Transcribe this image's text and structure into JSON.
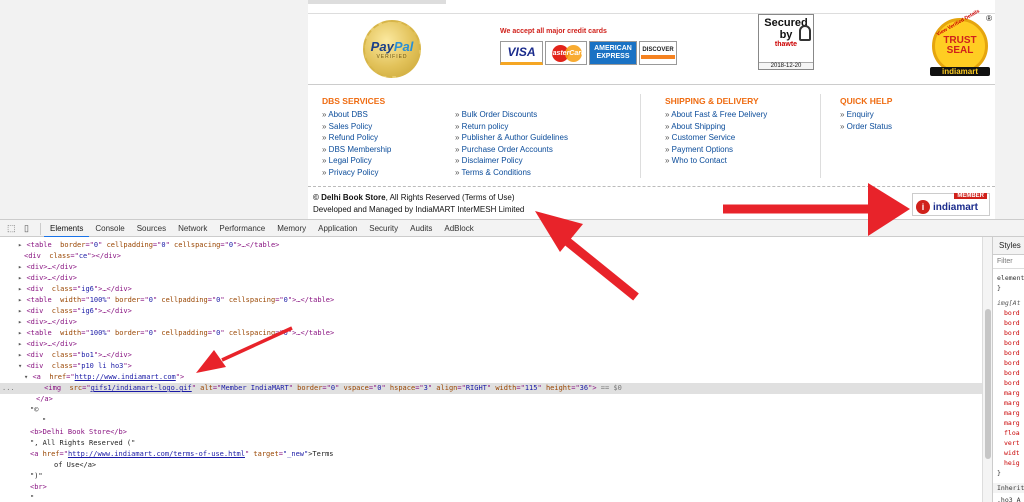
{
  "site": {
    "paypal": {
      "brand_a": "Pay",
      "brand_b": "Pal",
      "sub": "VERIFIED"
    },
    "cards": {
      "title": "We accept all major credit cards",
      "visa": "VISA",
      "mastercard": "MasterCard",
      "amex_line1": "AMERICAN",
      "amex_line2": "EXPRESS",
      "discover": "DISCOVER"
    },
    "secured": {
      "line1": "Secured",
      "line2": "by",
      "brand": "thawte",
      "date": "2018-12-20"
    },
    "trust_seal": {
      "arc": "View Verified Details",
      "line1": "TRUST",
      "line2": "SEAL",
      "brand": "indiamart",
      "reg": "®"
    },
    "footer": {
      "columns": [
        {
          "heading": "DBS SERVICES",
          "items": [
            "About DBS",
            "Sales Policy",
            "Refund Policy",
            "DBS Membership",
            "Legal Policy",
            "Privacy Policy"
          ]
        },
        {
          "heading": "",
          "items": [
            "Bulk Order Discounts",
            "Return policy",
            "Publisher & Author Guidelines",
            "Purchase Order Accounts",
            "Disclaimer Policy",
            "Terms & Conditions"
          ]
        },
        {
          "heading": "SHIPPING & DELIVERY",
          "items": [
            "About Fast & Free Delivery",
            "About Shipping",
            "Customer Service",
            "Payment Options",
            "Who to Contact"
          ]
        },
        {
          "heading": "QUICK HELP",
          "items": [
            "Enquiry",
            "Order Status"
          ]
        }
      ],
      "copyright_brand": "© Delhi Book Store",
      "copyright_rest": ", All Rights Reserved (Terms of Use)",
      "developed": "Developed and Managed by IndiaMART InterMESH Limited",
      "member_badge": "MEMBER",
      "member_brand": "indiamart",
      "member_icon_letter": "i"
    }
  },
  "devtools": {
    "tabs": [
      "Elements",
      "Console",
      "Sources",
      "Network",
      "Performance",
      "Memory",
      "Application",
      "Security",
      "Audits",
      "AdBlock"
    ],
    "active_tab": "Elements",
    "lines": [
      {
        "indent": 2,
        "tri": "▸",
        "pre": "<table ",
        "attrs": [
          [
            "border",
            "\"0\""
          ],
          [
            "cellpadding",
            "\"0\""
          ],
          [
            "cellspacing",
            "\"0\""
          ]
        ],
        "post": ">…</table>"
      },
      {
        "indent": 3,
        "tri": "",
        "pre": "<div ",
        "attrs": [
          [
            "class",
            "\"ce\""
          ]
        ],
        "post": "></div>"
      },
      {
        "indent": 2,
        "tri": "▸",
        "pre": "<div>…</div>",
        "attrs": [],
        "post": ""
      },
      {
        "indent": 2,
        "tri": "▸",
        "pre": "<div>…</div>",
        "attrs": [],
        "post": ""
      },
      {
        "indent": 2,
        "tri": "▸",
        "pre": "<div ",
        "attrs": [
          [
            "class",
            "\"ig6\""
          ]
        ],
        "post": ">…</div>"
      },
      {
        "indent": 2,
        "tri": "▸",
        "pre": "<table ",
        "attrs": [
          [
            "width",
            "\"100%\""
          ],
          [
            "border",
            "\"0\""
          ],
          [
            "cellpadding",
            "\"0\""
          ],
          [
            "cellspacing",
            "\"0\""
          ]
        ],
        "post": ">…</table>"
      },
      {
        "indent": 2,
        "tri": "▸",
        "pre": "<div ",
        "attrs": [
          [
            "class",
            "\"ig6\""
          ]
        ],
        "post": ">…</div>"
      },
      {
        "indent": 2,
        "tri": "▸",
        "pre": "<div>…</div>",
        "attrs": [],
        "post": ""
      },
      {
        "indent": 2,
        "tri": "▸",
        "pre": "<table ",
        "attrs": [
          [
            "width",
            "\"100%\""
          ],
          [
            "border",
            "\"0\""
          ],
          [
            "cellpadding",
            "\"0\""
          ],
          [
            "cellspacing",
            "\"0\""
          ]
        ],
        "post": ">…</table>"
      },
      {
        "indent": 2,
        "tri": "▸",
        "pre": "<div>…</div>",
        "attrs": [],
        "post": ""
      },
      {
        "indent": 2,
        "tri": "▸",
        "pre": "<div ",
        "attrs": [
          [
            "class",
            "\"bo1\""
          ]
        ],
        "post": ">…</div>"
      },
      {
        "indent": 2,
        "tri": "▾",
        "pre": "<div ",
        "attrs": [
          [
            "class",
            "\"p10 li ho3\""
          ]
        ],
        "post": ">"
      },
      {
        "indent": 3,
        "tri": "▾",
        "pre": "<a ",
        "attrs": [
          [
            "href",
            "link:http://www.indiamart.com"
          ]
        ],
        "post": ">"
      }
    ],
    "selected_line": {
      "prefix": "...",
      "tag": "<img ",
      "attrs": [
        [
          "src",
          "link:gifs1/indiamart-logo.gif"
        ],
        [
          "alt",
          "\"Member IndiaMART\""
        ],
        [
          "border",
          "\"0\""
        ],
        [
          "vspace",
          "\"0\""
        ],
        [
          "hspace",
          "\"3\""
        ],
        [
          "align",
          "\"RIGHT\""
        ],
        [
          "width",
          "\"115\""
        ],
        [
          "height",
          "\"36\""
        ]
      ],
      "post": ">",
      "suffix": " == $0"
    },
    "after_lines": [
      {
        "indent": 5,
        "kind": "tag",
        "text": "</a>"
      },
      {
        "indent": 4,
        "kind": "txt",
        "text": "\"©"
      },
      {
        "indent": 6,
        "kind": "txt",
        "text": "\""
      },
      {
        "indent": 4,
        "kind": "tag",
        "text": "<b>Delhi Book Store</b>"
      },
      {
        "indent": 4,
        "kind": "txt",
        "text": "\", All Rights Reserved (\""
      },
      {
        "indent": 4,
        "kind": "alink",
        "href": "http://www.indiamart.com/terms-of-use.html",
        "target": "\"_new\"",
        "tail": ">Terms"
      },
      {
        "indent": 8,
        "kind": "txt",
        "text": "of Use</a>"
      },
      {
        "indent": 4,
        "kind": "txt",
        "text": "\")\""
      },
      {
        "indent": 4,
        "kind": "tag",
        "text": "<br>"
      },
      {
        "indent": 4,
        "kind": "txt",
        "text": "\""
      }
    ],
    "styles": {
      "tab": "Styles",
      "filter_placeholder": "Filter",
      "element_line": "element",
      "element_close": "}",
      "rule_selector": "img[At",
      "props": [
        "bord",
        "bord",
        "bord",
        "bord",
        "bord",
        "bord",
        "bord",
        "bord",
        "marg",
        "marg",
        "marg",
        "marg",
        "floa",
        "vert",
        "widt",
        "heig"
      ],
      "rule_close": "}",
      "inherited": "Inherite",
      "inherited_sel": ".ho3 A"
    }
  },
  "colors": {
    "accent_orange": "#ef6c12",
    "link_blue": "#0b4c9a",
    "arrow_red": "#e8232a",
    "devtools_active": "#1a73e8"
  }
}
